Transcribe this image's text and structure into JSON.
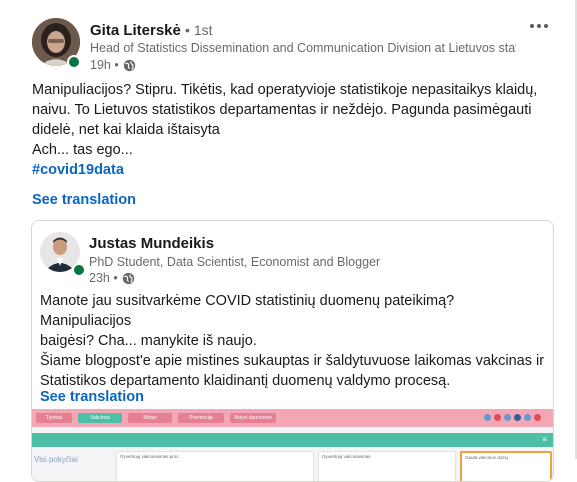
{
  "post": {
    "author": {
      "name": "Gita Literskė",
      "degree": "• 1st",
      "headline": "Head of Statistics Dissemination and Communication Division at Lietuvos statistikos departamentas",
      "time": "19h •"
    },
    "text_lines": [
      "Manipuliacijos? Stipru. Tikėtis, kad operatyvioje statistikoje nepasitaikys klaidų,",
      "naivu. To Lietuvos statistikos departamentas ir neždėjo. Pagunda pasimėgauti",
      "didelė, net kai klaida ištaisyta",
      "Ach... tas ego..."
    ],
    "hashtag": "#covid19data",
    "see_translation": "See translation",
    "more_icon": "more-horizontal-icon",
    "visibility_icon": "globe-icon"
  },
  "shared": {
    "author": {
      "name": "Justas Mundeikis",
      "headline": "PhD Student, Data Scientist, Economist and Blogger",
      "time": "23h •"
    },
    "text_lines": [
      "Manote jau susitvarkėme COVID statistinių duomenų pateikimą? Manipuliacijos",
      "baigėsi? Cha... manykite iš naujo.",
      "Šiame blogpost'e apie mistines sukauptas ir šaldytuvuose laikomas vakcinas ir",
      "Statistikos departamento klaidinantį duomenų valdymo procesą."
    ],
    "see_translation": "See translation",
    "preview": {
      "nav": [
        "Tyrimai",
        "Vakcinos",
        "Mirtys",
        "Prevencija",
        "Aktyvi duomenys"
      ],
      "panel_titles": [
        "Gyventojų vakcinavimas proc.",
        "Gyventojų vakcinavimas",
        "Gauta vakcinos dozių"
      ],
      "side_text": "Visi pokyčiai",
      "menu_symbol": "≡"
    }
  },
  "colors": {
    "link": "#0a66c2",
    "online": "#057642",
    "preview_pink": "#f3a7b4",
    "preview_teal": "#4cbfa6"
  }
}
